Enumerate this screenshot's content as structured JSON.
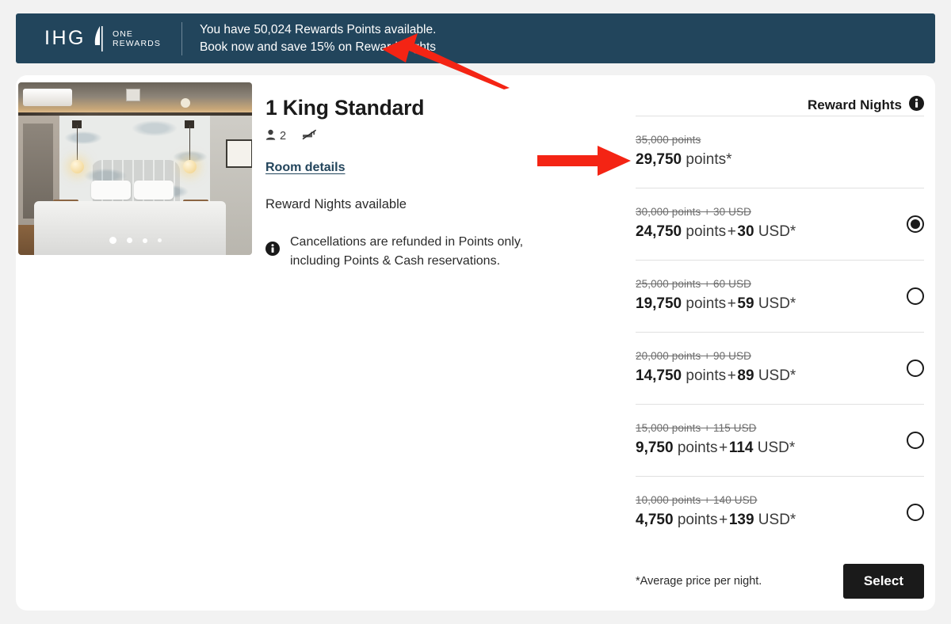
{
  "banner": {
    "logo_brand": "IHG",
    "logo_mark": "one-rewards-mark-icon",
    "logo_sub_line1": "One",
    "logo_sub_line2": "Rewards",
    "message_line1": "You have 50,024 Rewards Points available.",
    "message_line2": "Book now and save 15% on Reward Nights",
    "background_color": "#22455c"
  },
  "room": {
    "title": "1 King Standard",
    "occupancy_icon": "person-icon",
    "occupancy": "2",
    "smoking_icon": "no-smoking-icon",
    "details_link": "Room details",
    "availability": "Reward Nights available",
    "cancel_icon": "info-icon",
    "cancel_note": "Cancellations are refunded in Points only, including Points & Cash reservations.",
    "photo_alt": "room-photo",
    "carousel_dots": 4,
    "carousel_active_index": 0
  },
  "pricing": {
    "header_label": "Reward Nights",
    "header_icon": "info-icon",
    "options": [
      {
        "old_price": "35,000 points",
        "points": "29,750",
        "points_unit": "points*",
        "cash": "",
        "cash_unit": "",
        "has_radio": false,
        "selected": false
      },
      {
        "old_price": "30,000 points + 30 USD",
        "points": "24,750",
        "points_unit": "points",
        "cash": "30",
        "cash_unit": "USD*",
        "has_radio": true,
        "selected": true
      },
      {
        "old_price": "25,000 points + 60 USD",
        "points": "19,750",
        "points_unit": "points",
        "cash": "59",
        "cash_unit": "USD*",
        "has_radio": true,
        "selected": false
      },
      {
        "old_price": "20,000 points + 90 USD",
        "points": "14,750",
        "points_unit": "points",
        "cash": "89",
        "cash_unit": "USD*",
        "has_radio": true,
        "selected": false
      },
      {
        "old_price": "15,000 points + 115 USD",
        "points": "9,750",
        "points_unit": "points",
        "cash": "114",
        "cash_unit": "USD*",
        "has_radio": true,
        "selected": false
      },
      {
        "old_price": "10,000 points + 140 USD",
        "points": "4,750",
        "points_unit": "points",
        "cash": "139",
        "cash_unit": "USD*",
        "has_radio": true,
        "selected": false
      }
    ],
    "footnote": "*Average price per night.",
    "select_label": "Select"
  },
  "annotations": [
    {
      "name": "arrow-pointing-to-banner-message",
      "color": "#f42414"
    },
    {
      "name": "arrow-pointing-to-first-price-option",
      "color": "#f42414"
    }
  ]
}
